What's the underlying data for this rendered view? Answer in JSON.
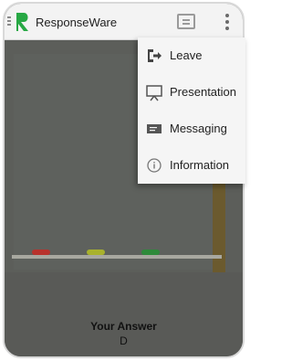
{
  "app": {
    "title": "ResponseWare"
  },
  "icons": {
    "drawer": "drawer-menu-icon",
    "logo": "responseware-logo",
    "slides": "slides-icon",
    "overflow": "overflow-menu-icon"
  },
  "menu": {
    "items": [
      {
        "label": "Leave",
        "icon": "exit-icon"
      },
      {
        "label": "Presentation",
        "icon": "presentation-icon"
      },
      {
        "label": "Messaging",
        "icon": "message-icon"
      },
      {
        "label": "Information",
        "icon": "info-icon"
      }
    ]
  },
  "answer": {
    "title": "Your Answer",
    "value": "D"
  },
  "colors": {
    "brand_green": "#27a844",
    "appbar": "#f3f3f3",
    "background": "#5b5d5a"
  }
}
